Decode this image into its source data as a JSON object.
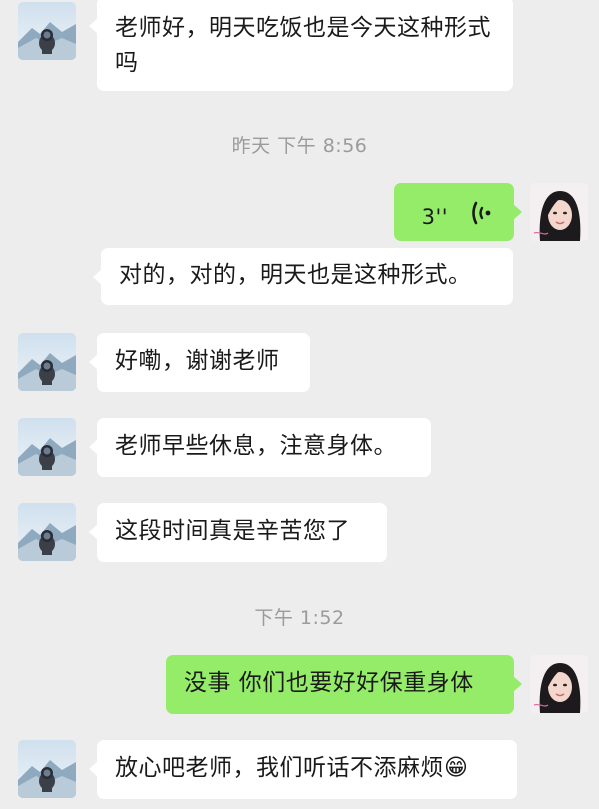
{
  "messages": {
    "m1": "老师好，明天吃饭也是今天这种形式吗",
    "m2_voice_duration": "3''",
    "m3": "对的，对的，明天也是这种形式。",
    "m4": "好嘞，谢谢老师",
    "m5": "老师早些休息，注意身体。",
    "m6": "这段时间真是辛苦您了",
    "m7": "没事 你们也要好好保重身体",
    "m8": "放心吧老师，我们听话不添麻烦😁"
  },
  "timestamps": {
    "t1": "昨天 下午 8:56",
    "t2": "下午 1:52"
  },
  "colors": {
    "background": "#ededed",
    "incoming_bubble": "#ffffff",
    "outgoing_bubble": "#95ec69",
    "timestamp": "#9b9b9b"
  },
  "icons": {
    "voice": "voice-wave-icon",
    "student_avatar": "astronaut-mountain-avatar",
    "teacher_avatar": "woman-portrait-avatar"
  }
}
